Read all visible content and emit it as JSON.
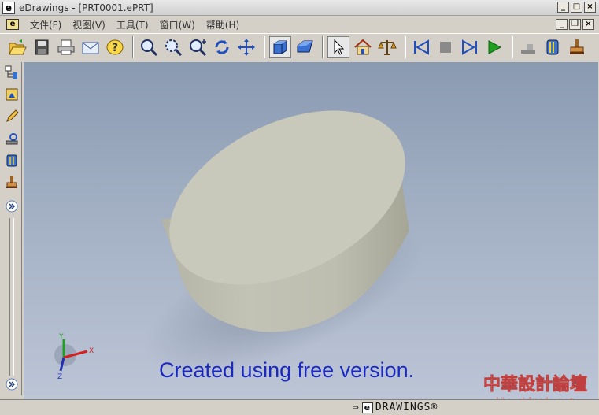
{
  "window": {
    "title": "eDrawings - [PRT0001.ePRT]",
    "app_icon_letter": "e"
  },
  "menu": {
    "items": [
      "文件(F)",
      "视图(V)",
      "工具(T)",
      "窗口(W)",
      "帮助(H)"
    ]
  },
  "toolbar": {
    "buttons": [
      "open-icon",
      "save-icon",
      "print-icon",
      "email-icon",
      "help-icon",
      "zoom-fit-icon",
      "zoom-area-icon",
      "zoom-in-out-icon",
      "rotate-icon",
      "pan-icon",
      "shaded-view-icon",
      "perspective-icon",
      "select-icon",
      "home-icon",
      "measure-icon",
      "first-frame-icon",
      "stop-icon",
      "next-frame-icon",
      "play-icon",
      "section-icon",
      "stamp-icon",
      "markup-icon"
    ]
  },
  "viewport": {
    "watermark": "Created using free version.",
    "triad": {
      "x": "X",
      "y": "Y",
      "z": "Z"
    }
  },
  "statusbar": {
    "brand": "DRAWINGS®",
    "brand_letter": "e"
  },
  "forum": {
    "name": "中華設計論壇",
    "url": "bbs.chinade.net"
  },
  "colors": {
    "background_top": "#8a9ab1",
    "background_bottom": "#bcc5d6",
    "part": "#c8c8bb",
    "watermark": "#1a28c0"
  }
}
